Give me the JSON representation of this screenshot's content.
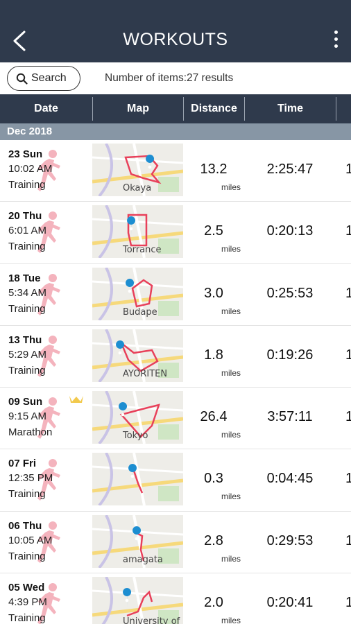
{
  "header": {
    "title": "WORKOUTS",
    "back_icon": "chevron-left-icon",
    "menu_icon": "more-vertical-icon",
    "bg": "#2f3a4c"
  },
  "search": {
    "label": "Search",
    "icon": "search-icon",
    "count_text": "Number of items:27 results"
  },
  "columns": [
    "Date",
    "Map",
    "Distance",
    "Time"
  ],
  "month": "Dec 2018",
  "accent": "#e8405a",
  "pin_color": "#1d8ed1",
  "workouts": [
    {
      "date": "23 Sun",
      "time_of_day": "10:02 AM",
      "type": "Training",
      "map_label": "Okaya",
      "distance": "13.2",
      "unit": "miles",
      "duration": "2:25:47",
      "crown": false
    },
    {
      "date": "20 Thu",
      "time_of_day": "6:01 AM",
      "type": "Training",
      "map_label": "Torrance",
      "distance": "2.5",
      "unit": "miles",
      "duration": "0:20:13",
      "crown": false
    },
    {
      "date": "18 Tue",
      "time_of_day": "5:34 AM",
      "type": "Training",
      "map_label": "Budape",
      "distance": "3.0",
      "unit": "miles",
      "duration": "0:25:53",
      "crown": false
    },
    {
      "date": "13 Thu",
      "time_of_day": "5:29 AM",
      "type": "Training",
      "map_label": "AYORITEN",
      "distance": "1.8",
      "unit": "miles",
      "duration": "0:19:26",
      "crown": false
    },
    {
      "date": "09 Sun",
      "time_of_day": "9:15 AM",
      "type": "Marathon",
      "map_label": "Tokyo",
      "distance": "26.4",
      "unit": "miles",
      "duration": "3:57:11",
      "crown": true
    },
    {
      "date": "07 Fri",
      "time_of_day": "12:35 PM",
      "type": "Training",
      "map_label": "",
      "distance": "0.3",
      "unit": "miles",
      "duration": "0:04:45",
      "crown": false
    },
    {
      "date": "06 Thu",
      "time_of_day": "10:05 AM",
      "type": "Training",
      "map_label": "amagata",
      "distance": "2.8",
      "unit": "miles",
      "duration": "0:29:53",
      "crown": false
    },
    {
      "date": "05 Wed",
      "time_of_day": "4:39 PM",
      "type": "Training",
      "map_label": "University of California, LA",
      "distance": "2.0",
      "unit": "miles",
      "duration": "0:20:41",
      "crown": false
    }
  ]
}
